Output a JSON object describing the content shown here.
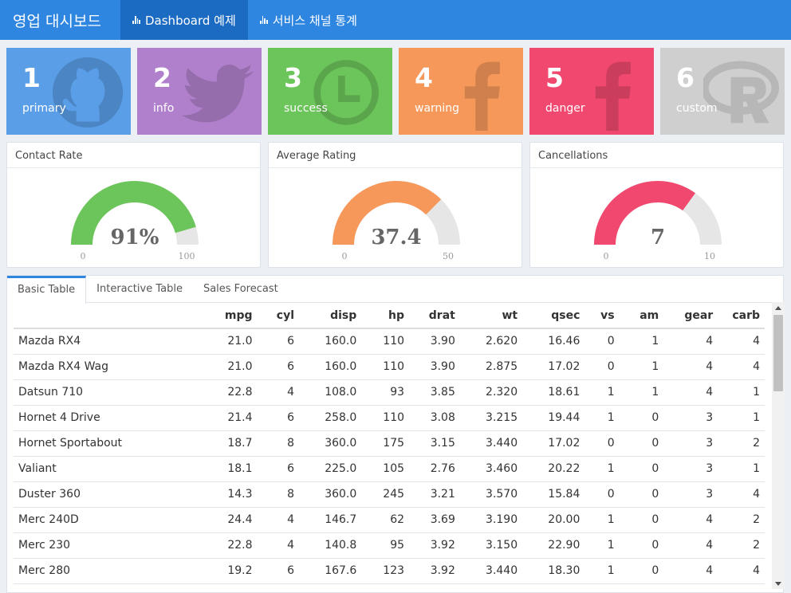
{
  "header": {
    "brand": "영업 대시보드",
    "tabs": [
      {
        "label": "Dashboard 예제",
        "icon": "bar-chart-icon"
      },
      {
        "label": "서비스 채널 통계",
        "icon": "bar-chart-icon"
      }
    ]
  },
  "valueboxes": [
    {
      "value": "1",
      "label": "primary",
      "color": "#5a9ee8",
      "icon": "github-icon"
    },
    {
      "value": "2",
      "label": "info",
      "color": "#b080cc",
      "icon": "twitter-icon"
    },
    {
      "value": "3",
      "label": "success",
      "color": "#6cc55a",
      "icon": "clock-icon"
    },
    {
      "value": "4",
      "label": "warning",
      "color": "#f6985a",
      "icon": "facebook-icon"
    },
    {
      "value": "5",
      "label": "danger",
      "color": "#f0486e",
      "icon": "facebook-icon"
    },
    {
      "value": "6",
      "label": "custom",
      "color": "#cfcfcf",
      "icon": "r-logo-icon"
    }
  ],
  "gauges": [
    {
      "title": "Contact Rate",
      "value": 91,
      "display": "91%",
      "min": 0,
      "max": 100,
      "min_label": "0",
      "max_label": "100",
      "color": "#6cc55a"
    },
    {
      "title": "Average Rating",
      "value": 37.4,
      "display": "37.4",
      "min": 0,
      "max": 50,
      "min_label": "0",
      "max_label": "50",
      "color": "#f6985a"
    },
    {
      "title": "Cancellations",
      "value": 7,
      "display": "7",
      "min": 0,
      "max": 10,
      "min_label": "0",
      "max_label": "10",
      "color": "#f0486e"
    }
  ],
  "tabs": [
    "Basic Table",
    "Interactive Table",
    "Sales Forecast"
  ],
  "table": {
    "columns": [
      "",
      "mpg",
      "cyl",
      "disp",
      "hp",
      "drat",
      "wt",
      "qsec",
      "vs",
      "am",
      "gear",
      "carb"
    ],
    "rows": [
      [
        "Mazda RX4",
        "21.0",
        "6",
        "160.0",
        "110",
        "3.90",
        "2.620",
        "16.46",
        "0",
        "1",
        "4",
        "4"
      ],
      [
        "Mazda RX4 Wag",
        "21.0",
        "6",
        "160.0",
        "110",
        "3.90",
        "2.875",
        "17.02",
        "0",
        "1",
        "4",
        "4"
      ],
      [
        "Datsun 710",
        "22.8",
        "4",
        "108.0",
        "93",
        "3.85",
        "2.320",
        "18.61",
        "1",
        "1",
        "4",
        "1"
      ],
      [
        "Hornet 4 Drive",
        "21.4",
        "6",
        "258.0",
        "110",
        "3.08",
        "3.215",
        "19.44",
        "1",
        "0",
        "3",
        "1"
      ],
      [
        "Hornet Sportabout",
        "18.7",
        "8",
        "360.0",
        "175",
        "3.15",
        "3.440",
        "17.02",
        "0",
        "0",
        "3",
        "2"
      ],
      [
        "Valiant",
        "18.1",
        "6",
        "225.0",
        "105",
        "2.76",
        "3.460",
        "20.22",
        "1",
        "0",
        "3",
        "1"
      ],
      [
        "Duster 360",
        "14.3",
        "8",
        "360.0",
        "245",
        "3.21",
        "3.570",
        "15.84",
        "0",
        "0",
        "3",
        "4"
      ],
      [
        "Merc 240D",
        "24.4",
        "4",
        "146.7",
        "62",
        "3.69",
        "3.190",
        "20.00",
        "1",
        "0",
        "4",
        "2"
      ],
      [
        "Merc 230",
        "22.8",
        "4",
        "140.8",
        "95",
        "3.92",
        "3.150",
        "22.90",
        "1",
        "0",
        "4",
        "2"
      ],
      [
        "Merc 280",
        "19.2",
        "6",
        "167.6",
        "123",
        "3.92",
        "3.440",
        "18.30",
        "1",
        "0",
        "4",
        "4"
      ]
    ]
  }
}
